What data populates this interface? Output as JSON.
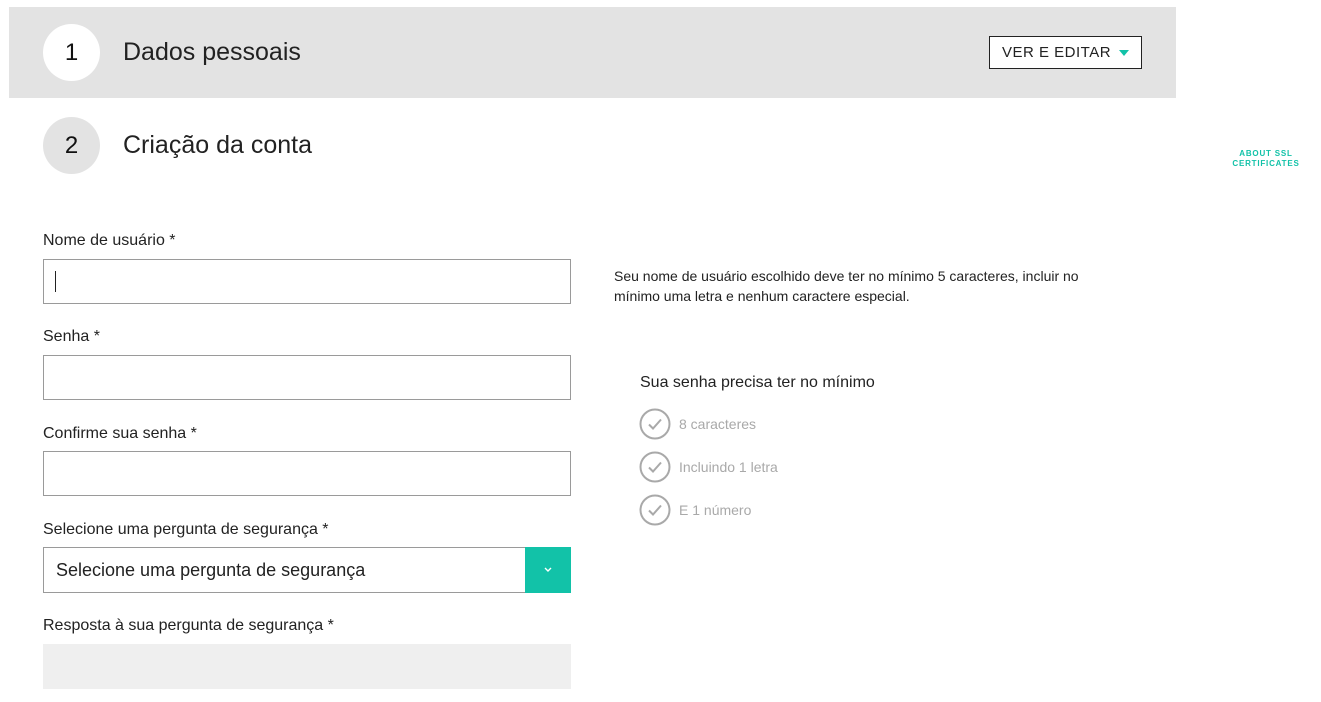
{
  "step1": {
    "number": "1",
    "title": "Dados pessoais",
    "edit_label": "VER E EDITAR"
  },
  "step2": {
    "number": "2",
    "title": "Criação da conta"
  },
  "ssl_link": {
    "line1": "ABOUT SSL",
    "line2": "CERTIFICATES"
  },
  "form": {
    "username_label": "Nome de usuário *",
    "username_value": "",
    "password_label": "Senha *",
    "password_value": "",
    "confirm_label": "Confirme sua senha *",
    "confirm_value": "",
    "question_label": "Selecione uma pergunta de segurança *",
    "question_selected": "Selecione uma pergunta de segurança",
    "answer_label": "Resposta à sua pergunta de segurança *",
    "answer_value": ""
  },
  "username_help": "Seu nome de usuário escolhido deve ter no mínimo 5 caracteres, incluir no mínimo uma letra e nenhum caractere especial.",
  "password_requirements": {
    "heading": "Sua senha precisa ter no mínimo",
    "items": [
      {
        "label": "8 caracteres",
        "icon": "check-circle-icon",
        "met": false
      },
      {
        "label": "Incluindo 1 letra",
        "icon": "check-circle-icon",
        "met": false
      },
      {
        "label": "E 1 número",
        "icon": "check-circle-icon",
        "met": false
      }
    ]
  },
  "colors": {
    "accent": "#12c2a8",
    "header_band": "#e3e3e3",
    "requirement_inactive": "#a9a9a9"
  }
}
